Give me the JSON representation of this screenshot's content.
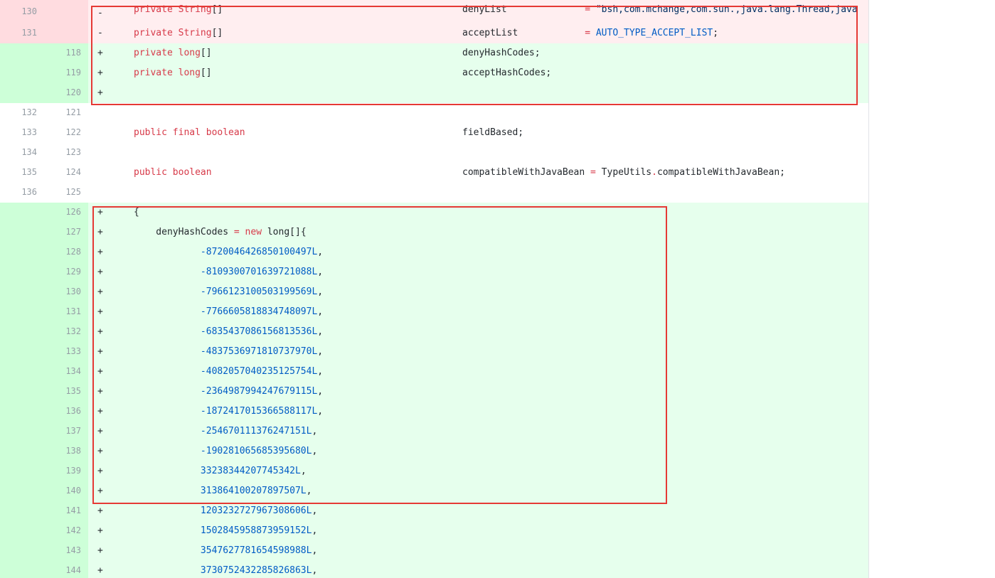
{
  "diff": {
    "header_rows": [
      {
        "type": "del",
        "old": "130",
        "new": "",
        "marker": "-",
        "tokens": [
          {
            "t": "private String",
            "c": "kw"
          },
          {
            "t": "[]",
            "c": "plain"
          }
        ],
        "col2": [
          {
            "t": "denyList",
            "c": "plain"
          },
          {
            "t": "              ",
            "c": "plain"
          },
          {
            "t": "= ",
            "c": "op"
          },
          {
            "t": "\"bsh,com.mchange,com.sun.,java.lang.Thread,java",
            "c": "str"
          }
        ]
      },
      {
        "type": "del",
        "old": "131",
        "new": "",
        "marker": "-",
        "tokens": [
          {
            "t": "private String",
            "c": "kw"
          },
          {
            "t": "[]",
            "c": "plain"
          }
        ],
        "col2": [
          {
            "t": "acceptList",
            "c": "plain"
          },
          {
            "t": "            ",
            "c": "plain"
          },
          {
            "t": "= ",
            "c": "op"
          },
          {
            "t": "AUTO_TYPE_ACCEPT_LIST",
            "c": "const"
          },
          {
            "t": ";",
            "c": "plain"
          }
        ]
      },
      {
        "type": "add",
        "old": "",
        "new": "118",
        "marker": "+",
        "tokens": [
          {
            "t": "private long",
            "c": "kw"
          },
          {
            "t": "[]",
            "c": "plain"
          }
        ],
        "col2": [
          {
            "t": "denyHashCodes;",
            "c": "plain"
          }
        ]
      },
      {
        "type": "add",
        "old": "",
        "new": "119",
        "marker": "+",
        "tokens": [
          {
            "t": "private long",
            "c": "kw"
          },
          {
            "t": "[]",
            "c": "plain"
          }
        ],
        "col2": [
          {
            "t": "acceptHashCodes;",
            "c": "plain"
          }
        ]
      },
      {
        "type": "add",
        "old": "",
        "new": "120",
        "marker": "+",
        "tokens": [],
        "col2": []
      },
      {
        "type": "ctx",
        "old": "132",
        "new": "121",
        "marker": "",
        "tokens": [],
        "col2": []
      },
      {
        "type": "ctx",
        "old": "133",
        "new": "122",
        "marker": "",
        "tokens": [
          {
            "t": "public final boolean",
            "c": "kw"
          }
        ],
        "col2": [
          {
            "t": "fieldBased;",
            "c": "plain"
          }
        ]
      },
      {
        "type": "ctx",
        "old": "134",
        "new": "123",
        "marker": "",
        "tokens": [],
        "col2": []
      },
      {
        "type": "ctx",
        "old": "135",
        "new": "124",
        "marker": "",
        "tokens": [
          {
            "t": "public boolean",
            "c": "kw"
          }
        ],
        "col2": [
          {
            "t": "compatibleWithJavaBean ",
            "c": "plain"
          },
          {
            "t": "= ",
            "c": "op"
          },
          {
            "t": "TypeUtils",
            "c": "plain"
          },
          {
            "t": ".",
            "c": "op"
          },
          {
            "t": "compatibleWithJavaBean;",
            "c": "plain"
          }
        ]
      },
      {
        "type": "ctx",
        "old": "136",
        "new": "125",
        "marker": "",
        "tokens": [],
        "col2": []
      },
      {
        "type": "add",
        "old": "",
        "new": "126",
        "marker": "+",
        "tokens": [
          {
            "t": "{",
            "c": "plain"
          }
        ],
        "col2": []
      },
      {
        "type": "add",
        "old": "",
        "new": "127",
        "marker": "+",
        "tokens": [
          {
            "t": "    denyHashCodes ",
            "c": "plain"
          },
          {
            "t": "= new ",
            "c": "kw"
          },
          {
            "t": "long",
            "c": "plain"
          },
          {
            "t": "[]{",
            "c": "plain"
          }
        ],
        "col2": []
      },
      {
        "type": "add",
        "old": "",
        "new": "128",
        "marker": "+",
        "tokens": [
          {
            "t": "            ",
            "c": "plain"
          },
          {
            "t": "-8720046426850100497L",
            "c": "num"
          },
          {
            "t": ",",
            "c": "plain"
          }
        ],
        "col2": []
      },
      {
        "type": "add",
        "old": "",
        "new": "129",
        "marker": "+",
        "tokens": [
          {
            "t": "            ",
            "c": "plain"
          },
          {
            "t": "-8109300701639721088L",
            "c": "num"
          },
          {
            "t": ",",
            "c": "plain"
          }
        ],
        "col2": []
      },
      {
        "type": "add",
        "old": "",
        "new": "130",
        "marker": "+",
        "tokens": [
          {
            "t": "            ",
            "c": "plain"
          },
          {
            "t": "-7966123100503199569L",
            "c": "num"
          },
          {
            "t": ",",
            "c": "plain"
          }
        ],
        "col2": []
      },
      {
        "type": "add",
        "old": "",
        "new": "131",
        "marker": "+",
        "tokens": [
          {
            "t": "            ",
            "c": "plain"
          },
          {
            "t": "-7766605818834748097L",
            "c": "num"
          },
          {
            "t": ",",
            "c": "plain"
          }
        ],
        "col2": []
      },
      {
        "type": "add",
        "old": "",
        "new": "132",
        "marker": "+",
        "tokens": [
          {
            "t": "            ",
            "c": "plain"
          },
          {
            "t": "-6835437086156813536L",
            "c": "num"
          },
          {
            "t": ",",
            "c": "plain"
          }
        ],
        "col2": []
      },
      {
        "type": "add",
        "old": "",
        "new": "133",
        "marker": "+",
        "tokens": [
          {
            "t": "            ",
            "c": "plain"
          },
          {
            "t": "-4837536971810737970L",
            "c": "num"
          },
          {
            "t": ",",
            "c": "plain"
          }
        ],
        "col2": []
      },
      {
        "type": "add",
        "old": "",
        "new": "134",
        "marker": "+",
        "tokens": [
          {
            "t": "            ",
            "c": "plain"
          },
          {
            "t": "-4082057040235125754L",
            "c": "num"
          },
          {
            "t": ",",
            "c": "plain"
          }
        ],
        "col2": []
      },
      {
        "type": "add",
        "old": "",
        "new": "135",
        "marker": "+",
        "tokens": [
          {
            "t": "            ",
            "c": "plain"
          },
          {
            "t": "-2364987994247679115L",
            "c": "num"
          },
          {
            "t": ",",
            "c": "plain"
          }
        ],
        "col2": []
      },
      {
        "type": "add",
        "old": "",
        "new": "136",
        "marker": "+",
        "tokens": [
          {
            "t": "            ",
            "c": "plain"
          },
          {
            "t": "-1872417015366588117L",
            "c": "num"
          },
          {
            "t": ",",
            "c": "plain"
          }
        ],
        "col2": []
      },
      {
        "type": "add",
        "old": "",
        "new": "137",
        "marker": "+",
        "tokens": [
          {
            "t": "            ",
            "c": "plain"
          },
          {
            "t": "-254670111376247151L",
            "c": "num"
          },
          {
            "t": ",",
            "c": "plain"
          }
        ],
        "col2": []
      },
      {
        "type": "add",
        "old": "",
        "new": "138",
        "marker": "+",
        "tokens": [
          {
            "t": "            ",
            "c": "plain"
          },
          {
            "t": "-190281065685395680L",
            "c": "num"
          },
          {
            "t": ",",
            "c": "plain"
          }
        ],
        "col2": []
      },
      {
        "type": "add",
        "old": "",
        "new": "139",
        "marker": "+",
        "tokens": [
          {
            "t": "            ",
            "c": "plain"
          },
          {
            "t": "33238344207745342L",
            "c": "num"
          },
          {
            "t": ",",
            "c": "plain"
          }
        ],
        "col2": []
      },
      {
        "type": "add",
        "old": "",
        "new": "140",
        "marker": "+",
        "tokens": [
          {
            "t": "            ",
            "c": "plain"
          },
          {
            "t": "313864100207897507L",
            "c": "num"
          },
          {
            "t": ",",
            "c": "plain"
          }
        ],
        "col2": []
      },
      {
        "type": "add",
        "old": "",
        "new": "141",
        "marker": "+",
        "tokens": [
          {
            "t": "            ",
            "c": "plain"
          },
          {
            "t": "1203232727967308606L",
            "c": "num"
          },
          {
            "t": ",",
            "c": "plain"
          }
        ],
        "col2": []
      },
      {
        "type": "add",
        "old": "",
        "new": "142",
        "marker": "+",
        "tokens": [
          {
            "t": "            ",
            "c": "plain"
          },
          {
            "t": "1502845958873959152L",
            "c": "num"
          },
          {
            "t": ",",
            "c": "plain"
          }
        ],
        "col2": []
      },
      {
        "type": "add",
        "old": "",
        "new": "143",
        "marker": "+",
        "tokens": [
          {
            "t": "            ",
            "c": "plain"
          },
          {
            "t": "3547627781654598988L",
            "c": "num"
          },
          {
            "t": ",",
            "c": "plain"
          }
        ],
        "col2": []
      },
      {
        "type": "add",
        "old": "",
        "new": "144",
        "marker": "+",
        "tokens": [
          {
            "t": "            ",
            "c": "plain"
          },
          {
            "t": "3730752432285826863L",
            "c": "num"
          },
          {
            "t": ",",
            "c": "plain"
          }
        ],
        "col2": []
      }
    ]
  },
  "colors": {
    "del_bg": "#ffeef0",
    "add_bg": "#e6ffed",
    "highlight": "#e53935"
  }
}
